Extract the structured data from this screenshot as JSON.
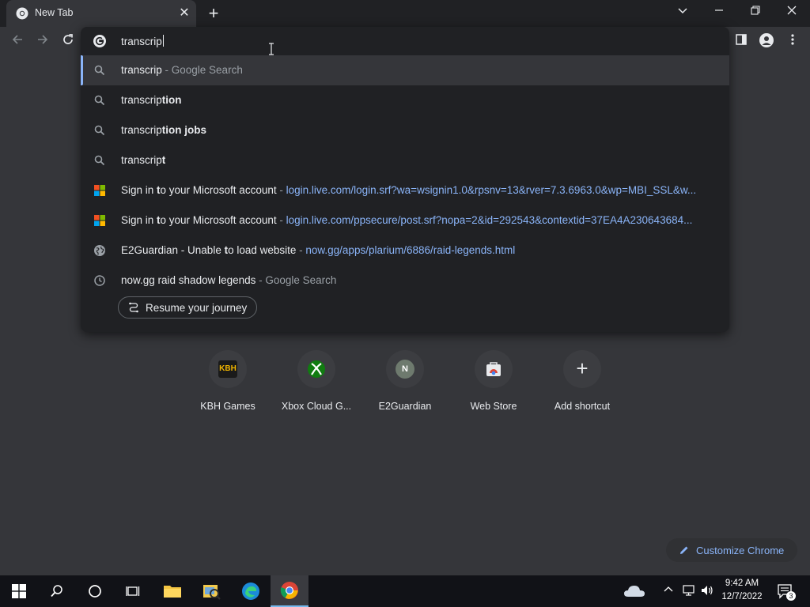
{
  "browser": {
    "tab_title": "New Tab",
    "omnibox_text": "transcrip"
  },
  "suggestions": [
    {
      "icon": "search-icon",
      "typed": "transcrip",
      "completion": "",
      "suffix": "Google Search",
      "selected": true
    },
    {
      "icon": "search-icon",
      "typed": "transcrip",
      "completion": "tion"
    },
    {
      "icon": "search-icon",
      "typed": "transcrip",
      "completion": "tion jobs"
    },
    {
      "icon": "search-icon",
      "typed": "transcrip",
      "completion": "t"
    },
    {
      "icon": "microsoft-logo-icon",
      "title_pre": "Sign in ",
      "title_bold": "t",
      "title_post": "o your Microsoft account",
      "url": "login.live.com/login.srf?wa=wsignin1.0&rpsnv=13&rver=7.3.6963.0&wp=MBI_SSL&w..."
    },
    {
      "icon": "microsoft-logo-icon",
      "title_pre": "Sign in ",
      "title_bold": "t",
      "title_post": "o your Microsoft account",
      "url": "login.live.com/ppsecure/post.srf?nopa=2&id=292543&contextid=37EA4A230643684..."
    },
    {
      "icon": "globe-icon",
      "title_pre": "E2Guardian - Unable ",
      "title_bold": "t",
      "title_post": "o load website",
      "url": "now.gg/apps/plarium/6886/raid-legends.html"
    },
    {
      "icon": "history-icon",
      "title_pre": "now.gg raid shadow legends",
      "suffix": "Google Search"
    }
  ],
  "journey_chip": "Resume your journey",
  "shortcuts": [
    {
      "label": "KBH Games",
      "icon_text": "KBH"
    },
    {
      "label": "Xbox Cloud G...",
      "icon_text": ""
    },
    {
      "label": "E2Guardian",
      "icon_text": "N"
    },
    {
      "label": "Web Store",
      "icon_text": ""
    },
    {
      "label": "Add shortcut",
      "icon_text": "+"
    }
  ],
  "customize_label": "Customize Chrome",
  "taskbar": {
    "time": "9:42 AM",
    "date": "12/7/2022",
    "notification_count": "3"
  },
  "colors": {
    "accent": "#8ab4f8",
    "background": "#35363a",
    "dropdown": "#202124"
  }
}
